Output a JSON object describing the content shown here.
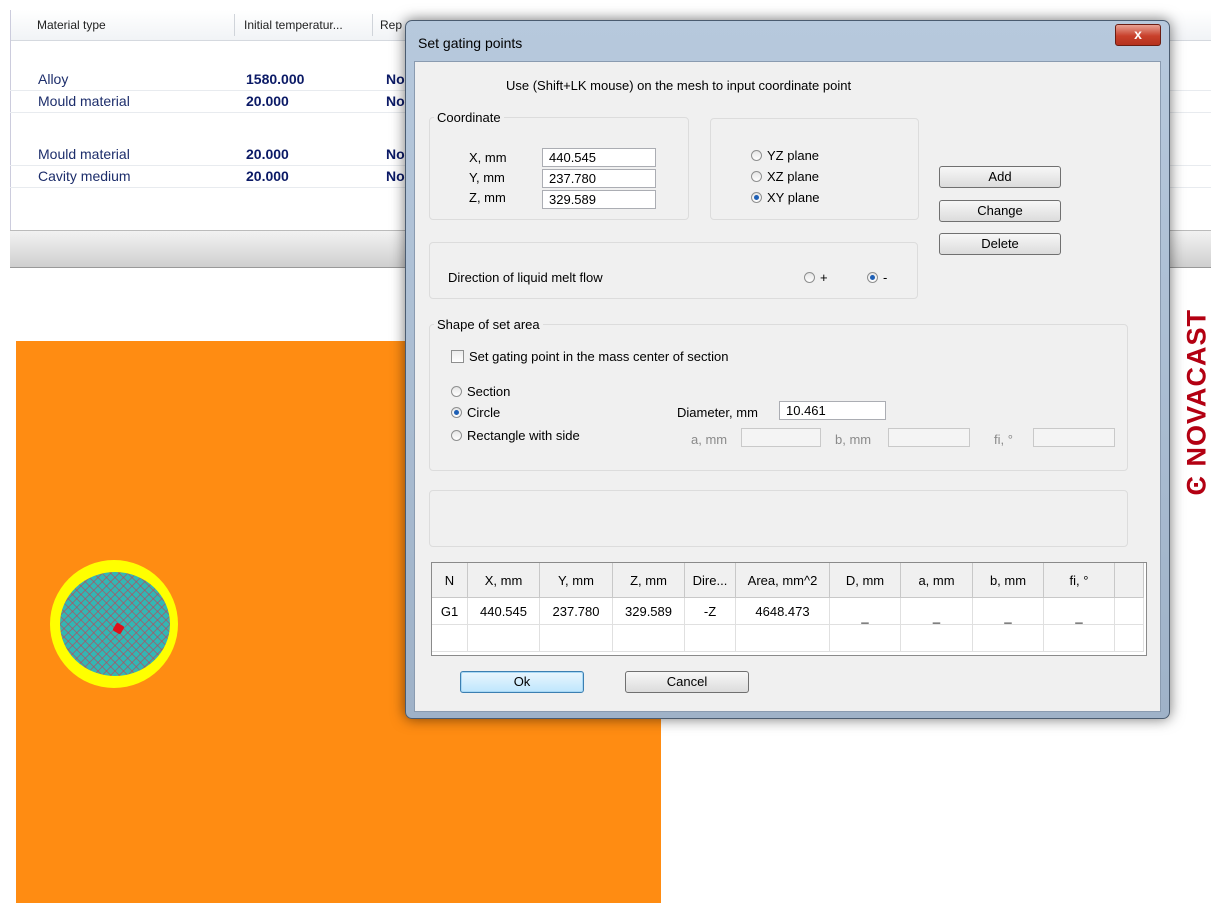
{
  "background_table": {
    "headers": [
      "Material type",
      "Initial temperatur...",
      "Rep"
    ],
    "rows": [
      {
        "material": "Alloy",
        "temp": "1580.000",
        "rep": "No"
      },
      {
        "material": "Mould material",
        "temp": "20.000",
        "rep": "No"
      },
      {
        "material": "Mould material",
        "temp": "20.000",
        "rep": "No"
      },
      {
        "material": "Cavity medium",
        "temp": "20.000",
        "rep": "No"
      }
    ]
  },
  "logo": {
    "text": "NOVACAST",
    "color": "#b30012"
  },
  "colors": {
    "canvas": "#ff8c12",
    "ring": "#ffff00",
    "mesh": "#33b6b4"
  },
  "dialog": {
    "title": "Set gating points",
    "close_glyph": "x",
    "hint": "Use (Shift+LK mouse) on the mesh to input coordinate point",
    "coordinate": {
      "legend": "Coordinate",
      "x_label": "X, mm",
      "x_value": "440.545",
      "y_label": "Y, mm",
      "y_value": "237.780",
      "z_label": "Z, mm",
      "z_value": "329.589"
    },
    "planes": {
      "yz": "YZ plane",
      "xz": "XZ plane",
      "xy": "XY plane",
      "selected": "XY plane"
    },
    "buttons": {
      "add": "Add",
      "change": "Change",
      "delete": "Delete",
      "ok": "Ok",
      "cancel": "Cancel"
    },
    "direction": {
      "label": "Direction of liquid melt flow",
      "plus": "+",
      "minus": "-",
      "selected": "-"
    },
    "shape": {
      "legend": "Shape of set area",
      "mass_center_label": "Set gating point in the mass center of section",
      "mass_center_checked": false,
      "section": "Section",
      "circle": "Circle",
      "rectangle": "Rectangle with side",
      "selected": "Circle",
      "diameter_label": "Diameter, mm",
      "diameter_value": "10.461",
      "a_label": "a, mm",
      "b_label": "b, mm",
      "fi_label": "fi, °"
    },
    "grid": {
      "columns": [
        "N",
        "X, mm",
        "Y, mm",
        "Z, mm",
        "Dire...",
        "Area, mm^2",
        "D, mm",
        "a, mm",
        "b, mm",
        "fi, °"
      ],
      "rows": [
        [
          "G1",
          "440.545",
          "237.780",
          "329.589",
          "-Z",
          "4648.473",
          "_",
          "_",
          "_",
          "_"
        ]
      ]
    }
  }
}
